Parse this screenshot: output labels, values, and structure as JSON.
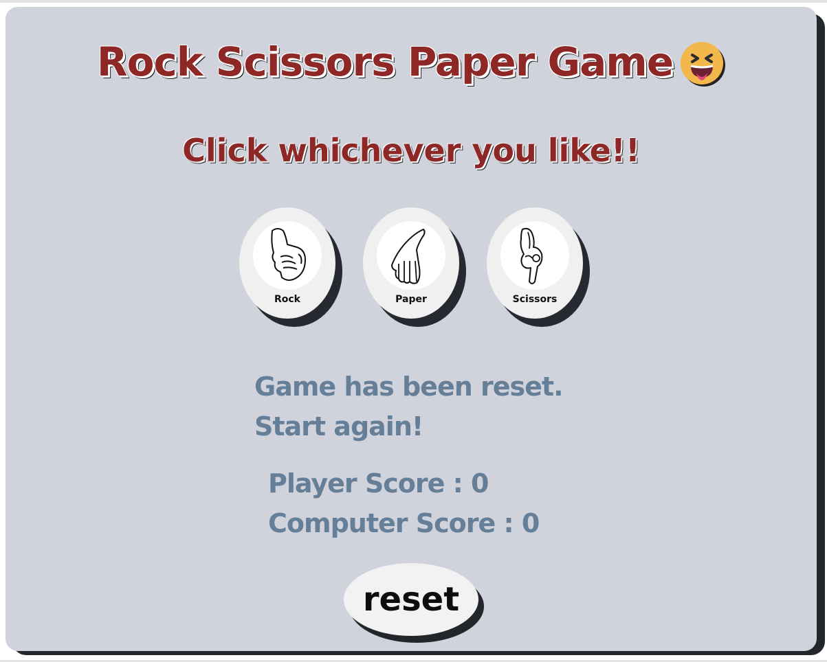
{
  "header": {
    "title": "Rock Scissors Paper Game",
    "title_emoji": "squinting-face-with-tongue-icon",
    "subtitle": "Click whichever you like!!"
  },
  "choices": [
    {
      "label": "Rock",
      "icon": "fist-hand-icon"
    },
    {
      "label": "Paper",
      "icon": "open-hand-icon"
    },
    {
      "label": "Scissors",
      "icon": "scissors-hand-icon"
    }
  ],
  "status": {
    "line1": "Game has been reset.",
    "line2": "Start again!"
  },
  "scores": {
    "player_label": "Player Score : ",
    "player_value": "0",
    "computer_label": "Computer Score : ",
    "computer_value": "0"
  },
  "controls": {
    "reset_label": "reset"
  },
  "colors": {
    "card_bg": "#d0d2dc",
    "title_red": "#8e2826",
    "status_blue": "#647f97",
    "shadow_dark": "#23272c",
    "button_bg": "#f0f0f0"
  }
}
